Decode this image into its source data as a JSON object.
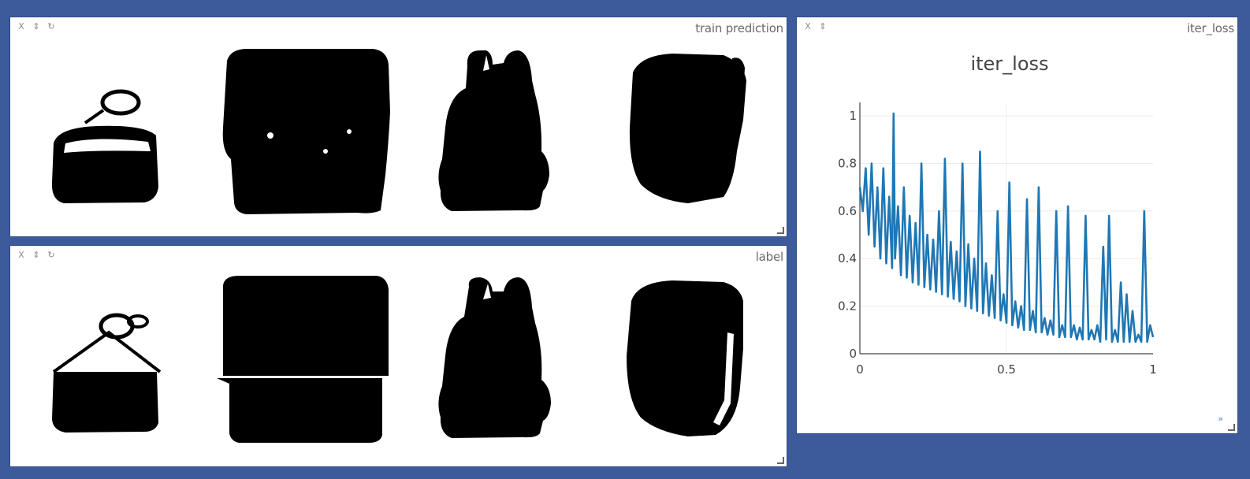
{
  "panes": {
    "prediction": {
      "title": "train prediction",
      "controls": [
        "X",
        "⇕",
        "↻"
      ],
      "images": [
        "handbag-mask",
        "suitcase-mask",
        "backpack-mask",
        "bag-mask"
      ]
    },
    "label": {
      "title": "label",
      "controls": [
        "X",
        "⇕",
        "↻"
      ],
      "images": [
        "handbag-mask",
        "suitcase-mask",
        "backpack-mask",
        "bag-mask"
      ]
    },
    "loss": {
      "title": "iter_loss",
      "controls": [
        "X",
        "⇕"
      ],
      "expand_label": "»"
    }
  },
  "chart_data": {
    "type": "line",
    "title": "iter_loss",
    "xlabel": "",
    "ylabel": "",
    "xlim": [
      0,
      1
    ],
    "ylim": [
      0,
      1.05
    ],
    "x_ticks": [
      "0",
      "0.5",
      "1"
    ],
    "y_ticks": [
      "0",
      "0.2",
      "0.4",
      "0.6",
      "0.8",
      "1"
    ],
    "grid": true,
    "color": "#1f77b4",
    "series": [
      {
        "x": [
          0,
          0.01,
          0.02,
          0.03,
          0.04,
          0.05,
          0.06,
          0.07,
          0.08,
          0.09,
          0.1,
          0.11,
          0.115,
          0.12,
          0.13,
          0.14,
          0.15,
          0.16,
          0.17,
          0.18,
          0.19,
          0.2,
          0.21,
          0.22,
          0.23,
          0.24,
          0.25,
          0.26,
          0.27,
          0.28,
          0.29,
          0.3,
          0.31,
          0.32,
          0.33,
          0.34,
          0.35,
          0.36,
          0.37,
          0.38,
          0.39,
          0.4,
          0.41,
          0.42,
          0.43,
          0.44,
          0.45,
          0.46,
          0.47,
          0.48,
          0.49,
          0.5,
          0.51,
          0.52,
          0.53,
          0.54,
          0.55,
          0.56,
          0.57,
          0.58,
          0.59,
          0.6,
          0.61,
          0.62,
          0.63,
          0.64,
          0.65,
          0.66,
          0.67,
          0.68,
          0.69,
          0.7,
          0.71,
          0.72,
          0.73,
          0.74,
          0.75,
          0.76,
          0.77,
          0.78,
          0.79,
          0.8,
          0.81,
          0.82,
          0.83,
          0.84,
          0.85,
          0.86,
          0.87,
          0.88,
          0.89,
          0.9,
          0.91,
          0.92,
          0.93,
          0.94,
          0.95,
          0.96,
          0.97,
          0.98,
          0.99,
          1.0
        ],
        "y": [
          0.7,
          0.6,
          0.78,
          0.5,
          0.8,
          0.45,
          0.7,
          0.4,
          0.78,
          0.38,
          0.66,
          0.36,
          1.01,
          0.4,
          0.62,
          0.33,
          0.7,
          0.32,
          0.58,
          0.3,
          0.55,
          0.29,
          0.8,
          0.28,
          0.5,
          0.27,
          0.48,
          0.26,
          0.6,
          0.25,
          0.82,
          0.24,
          0.47,
          0.23,
          0.43,
          0.22,
          0.8,
          0.2,
          0.46,
          0.19,
          0.4,
          0.18,
          0.85,
          0.17,
          0.38,
          0.16,
          0.33,
          0.15,
          0.6,
          0.14,
          0.25,
          0.13,
          0.72,
          0.12,
          0.22,
          0.11,
          0.2,
          0.1,
          0.65,
          0.1,
          0.18,
          0.09,
          0.7,
          0.09,
          0.15,
          0.08,
          0.14,
          0.08,
          0.6,
          0.07,
          0.12,
          0.07,
          0.62,
          0.07,
          0.12,
          0.06,
          0.11,
          0.06,
          0.58,
          0.06,
          0.1,
          0.06,
          0.12,
          0.05,
          0.45,
          0.06,
          0.58,
          0.05,
          0.1,
          0.05,
          0.3,
          0.05,
          0.25,
          0.05,
          0.18,
          0.05,
          0.08,
          0.05,
          0.6,
          0.05,
          0.12,
          0.07
        ]
      }
    ]
  }
}
